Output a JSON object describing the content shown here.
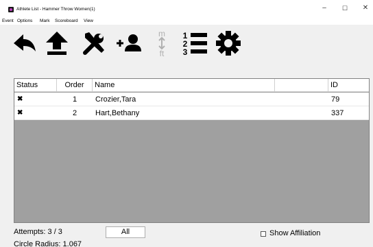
{
  "window": {
    "title": "Athlete List - Hammer Throw Women(1)",
    "minimize_glyph": "–",
    "maximize_glyph": "☐",
    "close_glyph": "✕"
  },
  "menu": [
    "Event",
    "Options",
    "Mark",
    "Scoreboard",
    "View"
  ],
  "toolbar": {
    "buttons": [
      {
        "icon": "back-arrow-icon",
        "enabled": true
      },
      {
        "icon": "upload-arrow-icon",
        "enabled": true
      },
      {
        "icon": "tools-icon",
        "enabled": true
      },
      {
        "icon": "add-person-icon",
        "enabled": true
      },
      {
        "icon": "metric-feet-toggle-icon",
        "enabled": false,
        "top_label": "m",
        "bottom_label": "ft"
      },
      {
        "icon": "numbered-list-icon",
        "enabled": true,
        "digits": [
          "1",
          "2",
          "3"
        ]
      },
      {
        "icon": "gear-icon",
        "enabled": true
      }
    ]
  },
  "table": {
    "columns": [
      "Status",
      "Order",
      "Name",
      "",
      "ID"
    ],
    "rows": [
      {
        "status": "✖",
        "order": "1",
        "name": "Crozier,Tara",
        "id": "79"
      },
      {
        "status": "✖",
        "order": "2",
        "name": "Hart,Bethany",
        "id": "337"
      }
    ]
  },
  "footer": {
    "attempts": "Attempts: 3 / 3",
    "circle_radius": "Circle Radius: 1.067",
    "all_button": "All",
    "show_affiliation": "Show Affiliation",
    "show_affiliation_checked": false
  },
  "colors": {
    "table_empty_bg": "#a0a0a0",
    "app_icon_accent": "#c040c0"
  }
}
